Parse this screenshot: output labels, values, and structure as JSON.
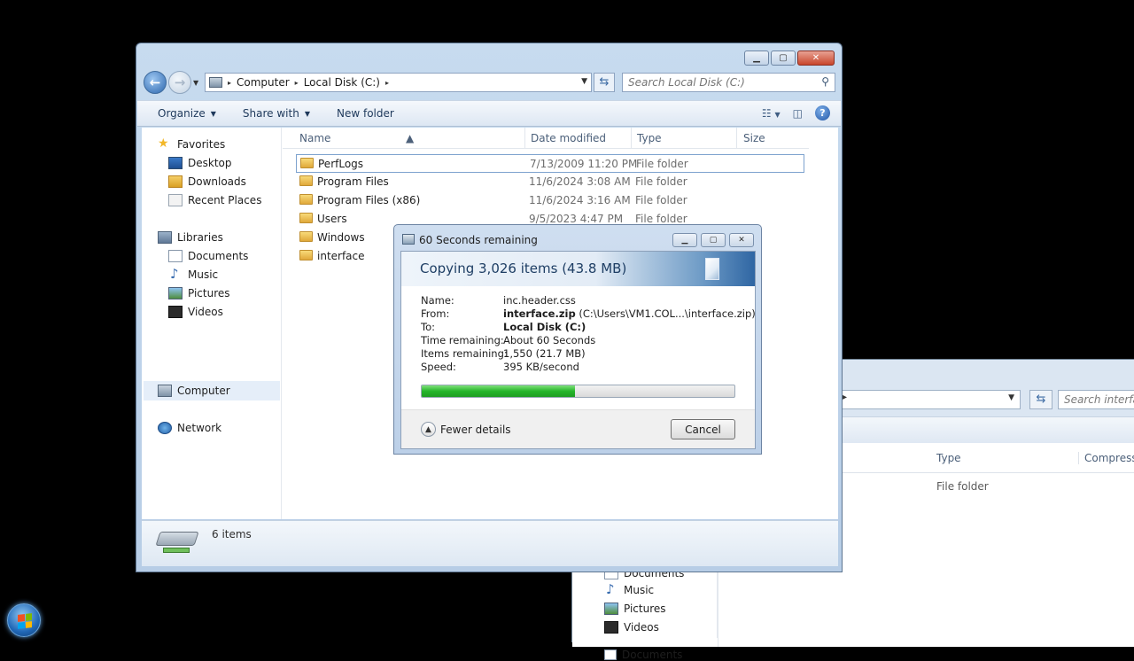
{
  "background_window": {
    "search_placeholder": "Search interfac",
    "col_type": "Type",
    "col_compressed": "Compressec",
    "row_type": "File folder",
    "nav_items": [
      "Documents",
      "Music",
      "Pictures",
      "Videos"
    ]
  },
  "window": {
    "address": {
      "crumbs": [
        "Computer",
        "Local Disk (C:)"
      ]
    },
    "search_placeholder": "Search Local Disk (C:)",
    "toolbar": {
      "organize": "Organize",
      "share_with": "Share with",
      "new_folder": "New folder"
    },
    "nav": {
      "favorites": "Favorites",
      "favorites_items": [
        "Desktop",
        "Downloads",
        "Recent Places"
      ],
      "libraries": "Libraries",
      "libraries_items": [
        "Documents",
        "Music",
        "Pictures",
        "Videos"
      ],
      "computer": "Computer",
      "network": "Network"
    },
    "columns": {
      "name": "Name",
      "date": "Date modified",
      "type": "Type",
      "size": "Size"
    },
    "files": [
      {
        "name": "PerfLogs",
        "date": "7/13/2009 11:20 PM",
        "type": "File folder"
      },
      {
        "name": "Program Files",
        "date": "11/6/2024 3:08 AM",
        "type": "File folder"
      },
      {
        "name": "Program Files (x86)",
        "date": "11/6/2024 3:16 AM",
        "type": "File folder"
      },
      {
        "name": "Users",
        "date": "9/5/2023 4:47 PM",
        "type": "File folder"
      },
      {
        "name": "Windows",
        "date": "",
        "type": ""
      },
      {
        "name": "interface",
        "date": "",
        "type": ""
      }
    ],
    "status": {
      "item_count": "6 items"
    }
  },
  "dialog": {
    "title": "60 Seconds remaining",
    "heading": "Copying 3,026 items (43.8 MB)",
    "labels": {
      "name": "Name:",
      "from": "From:",
      "to": "To:",
      "time": "Time remaining:",
      "items": "Items remaining:",
      "speed": "Speed:"
    },
    "values": {
      "name": "inc.header.css",
      "from_bold": "interface.zip",
      "from_rest": " (C:\\Users\\VM1.COL...\\interface.zip)",
      "to": "Local Disk (C:)",
      "time": "About 60 Seconds",
      "items": "1,550 (21.7 MB)",
      "speed": "395 KB/second"
    },
    "progress_percent": 49,
    "fewer_details": "Fewer details",
    "cancel": "Cancel"
  },
  "colors": {
    "progress": "#25b52a",
    "accent": "#2f66a3"
  }
}
